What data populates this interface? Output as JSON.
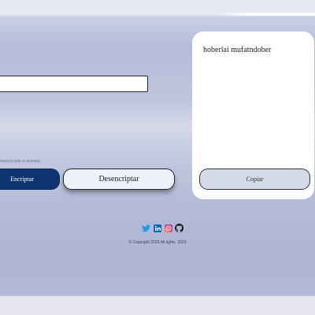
{
  "main": {
    "input_value": "",
    "hint": "mayúsculas ni acentos",
    "encrypt_label": "Encriptar",
    "decrypt_label": "Desencriptar"
  },
  "output": {
    "text": "hoberlai mufatndober",
    "copy_label": "Copiar"
  },
  "footer": {
    "icons": [
      "twitter-icon",
      "linkedin-icon",
      "instagram-icon",
      "github-icon"
    ],
    "copyright": "© Copyright 2023 All rights. 2023"
  },
  "colors": {
    "primary": "#0e3570",
    "card": "#ffffff",
    "copy_button": "#d5dae7"
  }
}
